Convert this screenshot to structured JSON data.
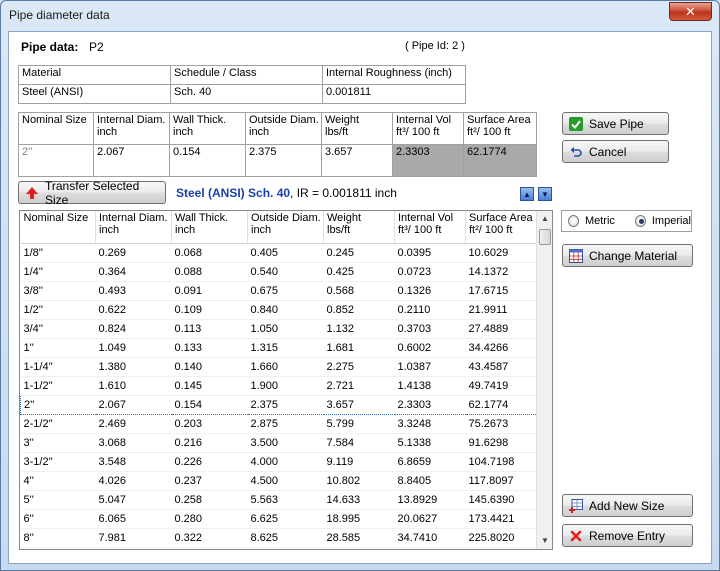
{
  "window": {
    "title": "Pipe diameter data",
    "close_glyph": "✕"
  },
  "pipe": {
    "label": "Pipe data:",
    "name": "P2",
    "pipe_id": "( Pipe Id: 2 )"
  },
  "material_table": {
    "headers": [
      "Material",
      "Schedule / Class",
      "Internal Roughness (inch)"
    ],
    "values": [
      "Steel (ANSI)",
      "Sch.  40",
      "0.001811"
    ]
  },
  "size_table": {
    "headers": [
      "Nominal Size",
      "Internal Diam.\ninch",
      "Wall Thick.\ninch",
      "Outside Diam.\ninch",
      "Weight\nlbs/ft",
      "Internal Vol\nft³/ 100 ft",
      "Surface Area\nft²/ 100 ft"
    ],
    "values": [
      "2''",
      "2.067",
      "0.154",
      "2.375",
      "3.657",
      "2.3303",
      "62.1774"
    ]
  },
  "buttons": {
    "save_pipe": "Save Pipe",
    "cancel": "Cancel",
    "transfer": "Transfer Selected Size",
    "change_material": "Change Material",
    "add_new_size": "Add New Size",
    "remove_entry": "Remove Entry"
  },
  "selection": {
    "material_text": "Steel (ANSI) Sch.  40",
    "ir_text": ", IR = 0.001811 inch"
  },
  "units": {
    "metric": "Metric",
    "imperial": "Imperial",
    "selected": "imperial"
  },
  "list": {
    "headers": [
      "Nominal Size",
      "Internal Diam.\ninch",
      "Wall Thick.\ninch",
      "Outside Diam.\ninch",
      "Weight\nlbs/ft",
      "Internal Vol\nft³/ 100 ft",
      "Surface Area\nft²/ 100 ft"
    ],
    "selected_index": 8,
    "rows": [
      [
        "1/8''",
        "0.269",
        "0.068",
        "0.405",
        "0.245",
        "0.0395",
        "10.6029"
      ],
      [
        "1/4''",
        "0.364",
        "0.088",
        "0.540",
        "0.425",
        "0.0723",
        "14.1372"
      ],
      [
        "3/8''",
        "0.493",
        "0.091",
        "0.675",
        "0.568",
        "0.1326",
        "17.6715"
      ],
      [
        "1/2''",
        "0.622",
        "0.109",
        "0.840",
        "0.852",
        "0.2110",
        "21.9911"
      ],
      [
        "3/4''",
        "0.824",
        "0.113",
        "1.050",
        "1.132",
        "0.3703",
        "27.4889"
      ],
      [
        "1''",
        "1.049",
        "0.133",
        "1.315",
        "1.681",
        "0.6002",
        "34.4266"
      ],
      [
        "1-1/4''",
        "1.380",
        "0.140",
        "1.660",
        "2.275",
        "1.0387",
        "43.4587"
      ],
      [
        "1-1/2''",
        "1.610",
        "0.145",
        "1.900",
        "2.721",
        "1.4138",
        "49.7419"
      ],
      [
        "2''",
        "2.067",
        "0.154",
        "2.375",
        "3.657",
        "2.3303",
        "62.1774"
      ],
      [
        "2-1/2''",
        "2.469",
        "0.203",
        "2.875",
        "5.799",
        "3.3248",
        "75.2673"
      ],
      [
        "3''",
        "3.068",
        "0.216",
        "3.500",
        "7.584",
        "5.1338",
        "91.6298"
      ],
      [
        "3-1/2''",
        "3.548",
        "0.226",
        "4.000",
        "9.119",
        "6.8659",
        "104.7198"
      ],
      [
        "4''",
        "4.026",
        "0.237",
        "4.500",
        "10.802",
        "8.8405",
        "117.8097"
      ],
      [
        "5''",
        "5.047",
        "0.258",
        "5.563",
        "14.633",
        "13.8929",
        "145.6390"
      ],
      [
        "6''",
        "6.065",
        "0.280",
        "6.625",
        "18.995",
        "20.0627",
        "173.4421"
      ],
      [
        "8''",
        "7.981",
        "0.322",
        "8.625",
        "28.585",
        "34.7410",
        "225.8020"
      ]
    ]
  },
  "colors": {
    "accent_blue": "#1a3fb0",
    "save_green": "#2a9a2a",
    "grey_cell": "#a9a9a9"
  }
}
